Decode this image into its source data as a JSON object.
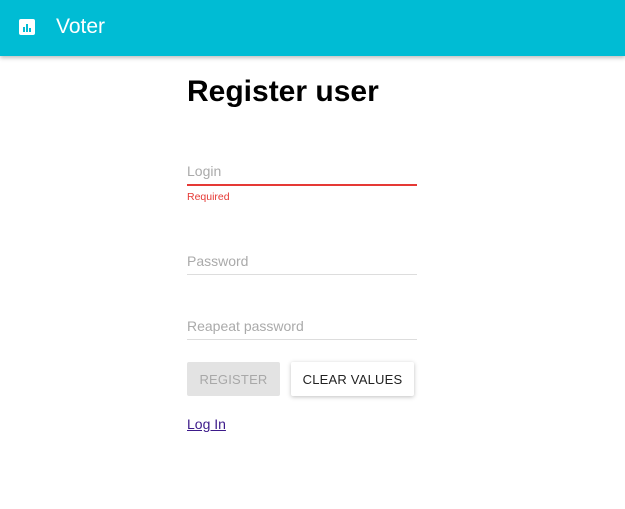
{
  "app": {
    "title": "Voter",
    "icon": "bar-chart-icon",
    "accent_color": "#00bcd4"
  },
  "page": {
    "title": "Register user"
  },
  "form": {
    "login": {
      "placeholder": "Login",
      "value": "",
      "error": "Required"
    },
    "password": {
      "placeholder": "Password",
      "value": ""
    },
    "repeat_password": {
      "placeholder": "Reapeat password",
      "value": ""
    },
    "register_label": "REGISTER",
    "clear_label": "CLEAR VALUES",
    "error_color": "#e53935"
  },
  "links": {
    "login_label": "Log In"
  }
}
